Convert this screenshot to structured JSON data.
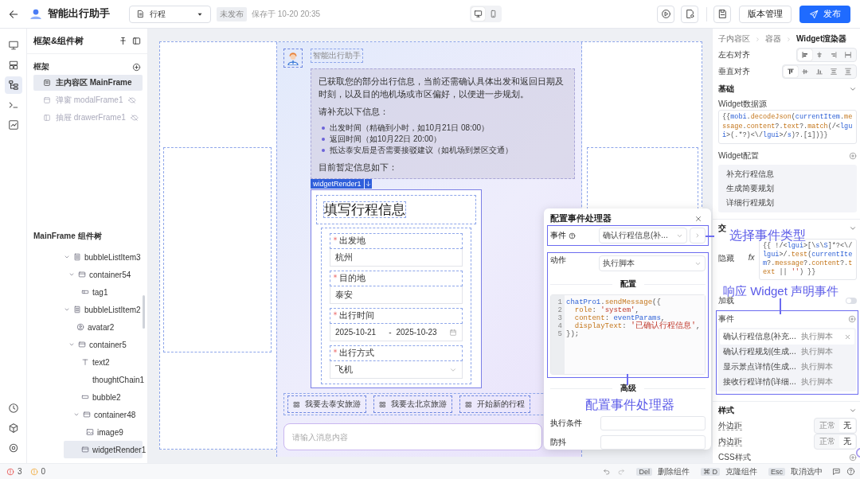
{
  "topbar": {
    "app_title": "智能出行助手",
    "page_select": "行程",
    "status_badge": "未发布",
    "saved_time": "保存于 10-20 20:35",
    "device_modes": [
      {
        "kind": "desktop",
        "selected": true
      },
      {
        "kind": "mobile",
        "selected": false
      }
    ],
    "version_button": "版本管理",
    "publish_button": "发布"
  },
  "rail": {
    "items": [
      {
        "kind": "desktop",
        "selected": false
      },
      {
        "kind": "layout",
        "selected": false
      },
      {
        "kind": "tree",
        "selected": true
      },
      {
        "kind": "terminal",
        "selected": false
      },
      {
        "kind": "chart",
        "selected": false
      }
    ],
    "bottom_items": [
      {
        "kind": "clock"
      },
      {
        "kind": "cube"
      },
      {
        "kind": "gear"
      }
    ]
  },
  "tree_panel": {
    "title": "框架&组件树",
    "frames_heading": "框架",
    "frames": [
      {
        "kind": "page",
        "label": "主内容区 MainFrame",
        "selected": true,
        "hidden": false
      },
      {
        "kind": "modal",
        "label": "弹窗 modalFrame1",
        "selected": false,
        "hidden": true
      },
      {
        "kind": "drawer",
        "label": "抽屉 drawerFrame1",
        "selected": false,
        "hidden": true
      }
    ],
    "components_heading": "MainFrame 组件树",
    "components": [
      {
        "kind": "list",
        "label": "bubbleListItem3",
        "selected": false,
        "expanded": true,
        "children": [
          {
            "kind": "container",
            "label": "container54",
            "selected": false,
            "expanded": true,
            "children": [
              {
                "kind": "tag",
                "label": "tag1",
                "selected": false
              }
            ]
          }
        ]
      },
      {
        "kind": "list",
        "label": "bubbleListItem2",
        "selected": false,
        "expanded": true,
        "children": [
          {
            "kind": "avatar",
            "label": "avatar2",
            "selected": false
          },
          {
            "kind": "container",
            "label": "container5",
            "selected": false,
            "expanded": true,
            "children": [
              {
                "kind": "text",
                "label": "text2",
                "selected": false
              },
              {
                "kind": "none",
                "label": "thoughtChain1",
                "selected": false
              },
              {
                "kind": "bubble",
                "label": "bubble2",
                "selected": false
              },
              {
                "kind": "container",
                "label": "container48",
                "selected": false,
                "expanded": true,
                "children": [
                  {
                    "kind": "image",
                    "label": "image9",
                    "selected": false
                  }
                ]
              },
              {
                "kind": "container",
                "label": "widgetRender1",
                "selected": true
              }
            ]
          }
        ]
      }
    ]
  },
  "canvas": {
    "bot_name": "智能出行助手",
    "message": {
      "intro": "已获取您的部分出行信息，当前还需确认具体出发和返回日期及时刻，以及目的地机场或市区偏好，以便进一步规划。",
      "prompt": "请补充以下信息：",
      "bullets": [
        "出发时间（精确到小时，如10月21日 08:00）",
        "返回时间（如10月22日 20:00）",
        "抵达泰安后是否需要接驳建议（如机场到景区交通）"
      ],
      "outro": "目前暂定信息如下："
    },
    "widget_tag": "widgetRender1",
    "form": {
      "title": "填写行程信息",
      "fields": [
        {
          "kind": "text",
          "label": "出发地",
          "required": true,
          "value": "杭州"
        },
        {
          "kind": "text",
          "label": "目的地",
          "required": true,
          "value": "泰安"
        },
        {
          "kind": "daterange",
          "label": "出行时间",
          "required": true,
          "start": "2025-10-21",
          "separator": "-",
          "end": "2025-10-23"
        },
        {
          "kind": "select",
          "label": "出行方式",
          "required": true,
          "value": "飞机"
        }
      ]
    },
    "suggestions": [
      "我要去泰安旅游",
      "我要去北京旅游",
      "开始新的行程"
    ],
    "input": {
      "placeholder": "请输入消息内容"
    }
  },
  "dialog": {
    "title": "配置事件处理器",
    "event_label": "事件",
    "event_value": "确认行程信息(补...",
    "action_label": "动作",
    "action_value": "执行脚本",
    "config_heading": "配置",
    "code": [
      {
        "line_number": "1",
        "text": "chatPro1.sendMessage({"
      },
      {
        "line_number": "2",
        "text": "  role: 'system',"
      },
      {
        "line_number": "3",
        "text": "  content: eventParams,"
      },
      {
        "line_number": "4",
        "text": "  displayText: '已确认行程信息',"
      },
      {
        "line_number": "5",
        "text": "});"
      }
    ],
    "advanced_heading": "高级",
    "condition_label": "执行条件",
    "debounce_label": "防抖"
  },
  "props": {
    "breadcrumb": [
      "子内容区",
      "容器",
      "Widget渲染器"
    ],
    "h_align": {
      "label": "左右对齐",
      "options": [
        {
          "kind": "left",
          "selected": true
        },
        {
          "kind": "center",
          "selected": false
        },
        {
          "kind": "right",
          "selected": false
        },
        {
          "kind": "stretch",
          "selected": false
        }
      ]
    },
    "v_align": {
      "label": "垂直对齐",
      "options": [
        {
          "kind": "top",
          "selected": true
        },
        {
          "kind": "middle",
          "selected": false
        },
        {
          "kind": "bottom",
          "selected": false
        },
        {
          "kind": "between",
          "selected": false
        },
        {
          "kind": "around",
          "selected": false
        }
      ]
    },
    "basic": {
      "heading": "基础",
      "datasource_label": "Widget数据源",
      "datasource_code": "{{mobi.decodeJson(currentItem.message.content?.text?.match(/<lgui>(.*?)<\\/lgui>/s)?.[1])}}",
      "config_label": "Widget配置",
      "configs": [
        "补充行程信息",
        "生成简要规划",
        "详细行程规划"
      ]
    },
    "interaction": {
      "heading": "交",
      "hidden_label": "隐藏",
      "fx": "fx",
      "hidden_code": "{{ !/<lgui>[\\s\\S]*?<\\/lgui>/.test(currentItem?.message?.content?.text || '') }}",
      "loading_label": "加载",
      "loading_on": false
    },
    "events": {
      "label": "事件",
      "items": [
        {
          "name": "确认行程信息(补充...",
          "action": "执行脚本",
          "selected": true
        },
        {
          "name": "确认行程规划(生成...",
          "action": "执行脚本",
          "selected": false
        },
        {
          "name": "显示景点详情(生成...",
          "action": "执行脚本",
          "selected": false
        },
        {
          "name": "接收行程详情(详细...",
          "action": "执行脚本",
          "selected": false
        }
      ]
    },
    "style": {
      "heading": "样式",
      "margin": {
        "label": "外边距",
        "options": [
          {
            "label": "正常",
            "selected": false
          },
          {
            "label": "无",
            "selected": true
          }
        ]
      },
      "padding": {
        "label": "内边距",
        "options": [
          {
            "label": "正常",
            "selected": false
          },
          {
            "label": "无",
            "selected": true
          }
        ]
      },
      "css_label": "CSS样式"
    }
  },
  "status_bar": {
    "errors": "3",
    "warnings": "0",
    "shortcuts": [
      {
        "key": "Del",
        "label": "删除组件"
      },
      {
        "key": "⌘ D",
        "label": "克隆组件"
      },
      {
        "key": "Esc",
        "label": "取消选中"
      }
    ]
  },
  "annotations": [
    {
      "text": "选择事件类型"
    },
    {
      "text": "响应 Widget 声明事件"
    },
    {
      "text": "配置事件处理器"
    }
  ]
}
